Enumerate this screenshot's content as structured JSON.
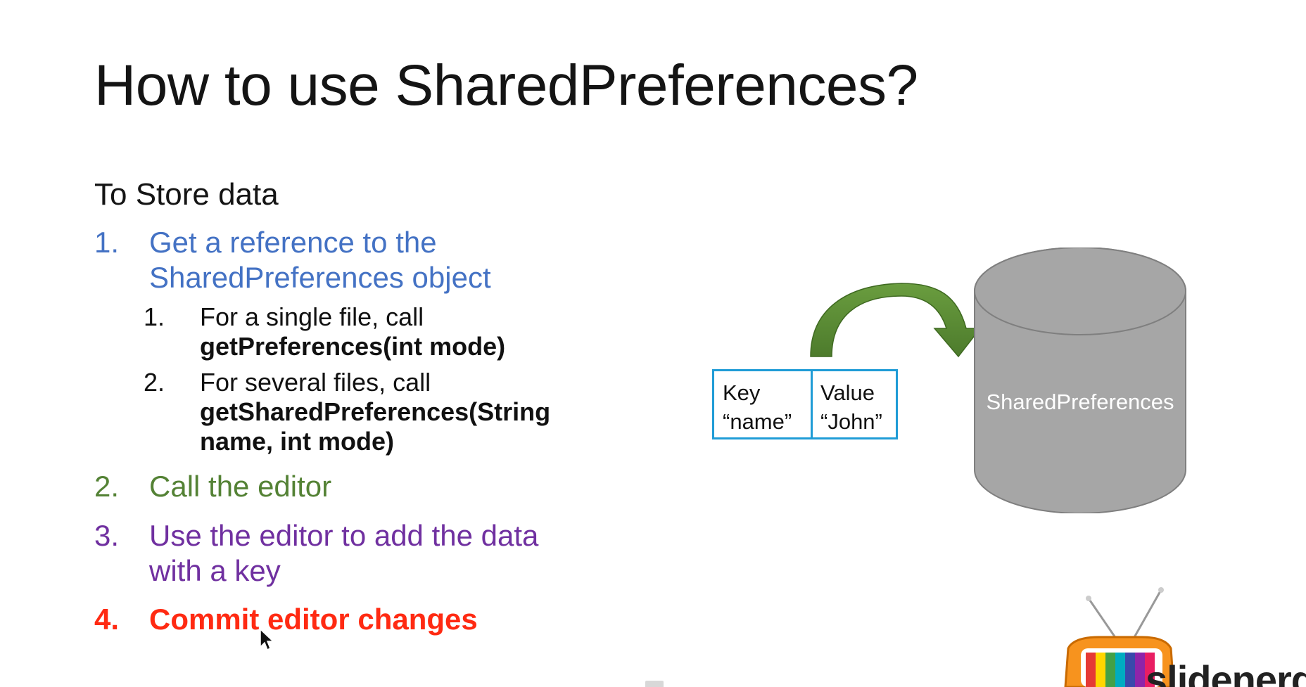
{
  "slide": {
    "title": "How to use SharedPreferences?",
    "subheading": "To Store data",
    "steps": [
      {
        "number": "1.",
        "text": "Get a reference to the SharedPreferences object",
        "line_1": "Get a reference to the",
        "line_2": "SharedPreferences object",
        "color": "#4472c4",
        "substeps": [
          {
            "number": "1.",
            "line_1": "For a single file, call",
            "code_1": "getPreferences(int mode)"
          },
          {
            "number": "2.",
            "line_1": "For several files, call",
            "code_1": "getSharedPreferences(String",
            "code_2": "name, int mode)"
          }
        ]
      },
      {
        "number": "2.",
        "text": "Call the editor",
        "color": "#548235"
      },
      {
        "number": "3.",
        "text": "Use the editor to add the data with a key",
        "line_1": "Use the editor to add the data",
        "line_2": "with a key",
        "color": "#7030a0"
      },
      {
        "number": "4.",
        "text": "Commit editor changes",
        "color": "#ff2a12"
      }
    ]
  },
  "diagram": {
    "key_label": "Key",
    "key_value": "“name”",
    "value_label": "Value",
    "value_value": "“John”",
    "store_label": "SharedPreferences",
    "arrow_color": "#548235",
    "box_border_color": "#1f9cd6",
    "cylinder_color": "#a6a6a6"
  },
  "branding": {
    "logo_text": "slidenerd",
    "logo_icon": "retro-tv-icon"
  },
  "cursor": {
    "icon": "mouse-pointer-icon"
  }
}
